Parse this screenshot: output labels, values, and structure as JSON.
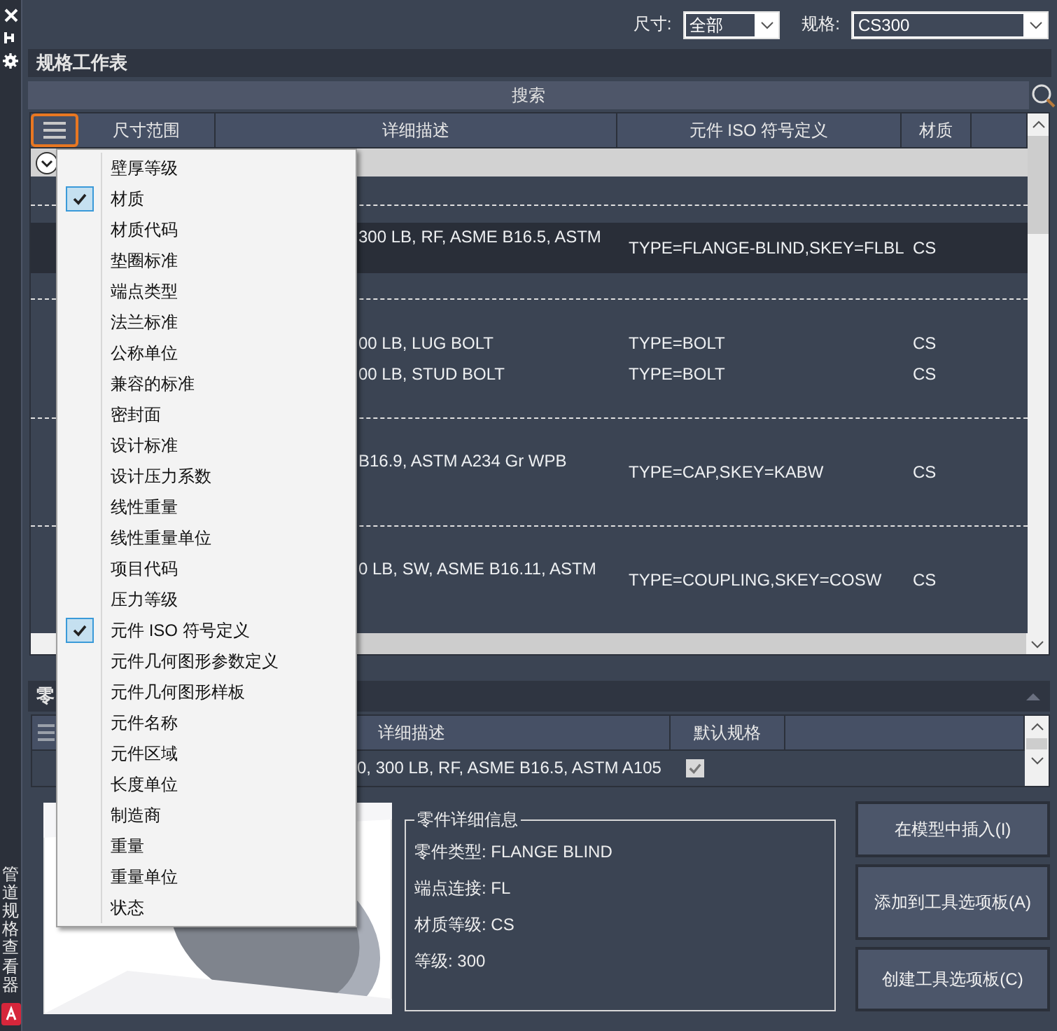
{
  "side_panel": {
    "title": "管道规格查看器"
  },
  "filters": [
    {
      "label": "尺寸:",
      "value": "全部"
    },
    {
      "label": "规格:",
      "value": "CS300"
    }
  ],
  "spec_sheet": {
    "title": "规格工作表",
    "search": {
      "placeholder": "搜索"
    },
    "columns": [
      "尺寸范围",
      "详细描述",
      "元件 ISO 符号定义",
      "材质"
    ],
    "rows": [
      {
        "selected": true,
        "lines": [
          {
            "description": "300 LB, RF, ASME B16.5, ASTM",
            "iso": "TYPE=FLANGE-BLIND,SKEY=FLBL",
            "material": "CS"
          }
        ]
      },
      {
        "selected": false,
        "lines": [
          {
            "description": "00 LB, LUG BOLT",
            "iso": "TYPE=BOLT",
            "material": "CS"
          },
          {
            "description": "00 LB, STUD BOLT",
            "iso": "TYPE=BOLT",
            "material": "CS"
          }
        ]
      },
      {
        "selected": false,
        "lines": [
          {
            "description": "B16.9, ASTM A234 Gr WPB",
            "iso": "TYPE=CAP,SKEY=KABW",
            "material": "CS"
          }
        ]
      },
      {
        "selected": false,
        "lines": [
          {
            "description": "0 LB, SW, ASME B16.11, ASTM",
            "iso": "TYPE=COUPLING,SKEY=COSW",
            "material": "CS"
          }
        ]
      }
    ]
  },
  "column_menu": [
    {
      "label": "壁厚等级",
      "checked": false
    },
    {
      "label": "材质",
      "checked": true
    },
    {
      "label": "材质代码",
      "checked": false
    },
    {
      "label": "垫圈标准",
      "checked": false
    },
    {
      "label": "端点类型",
      "checked": false
    },
    {
      "label": "法兰标准",
      "checked": false
    },
    {
      "label": "公称单位",
      "checked": false
    },
    {
      "label": "兼容的标准",
      "checked": false
    },
    {
      "label": "密封面",
      "checked": false
    },
    {
      "label": "设计标准",
      "checked": false
    },
    {
      "label": "设计压力系数",
      "checked": false
    },
    {
      "label": "线性重量",
      "checked": false
    },
    {
      "label": "线性重量单位",
      "checked": false
    },
    {
      "label": "项目代码",
      "checked": false
    },
    {
      "label": "压力等级",
      "checked": false
    },
    {
      "label": "元件 ISO 符号定义",
      "checked": true
    },
    {
      "label": "元件几何图形参数定义",
      "checked": false
    },
    {
      "label": "元件几何图形样板",
      "checked": false
    },
    {
      "label": "元件名称",
      "checked": false
    },
    {
      "label": "元件区域",
      "checked": false
    },
    {
      "label": "长度单位",
      "checked": false
    },
    {
      "label": "制造商",
      "checked": false
    },
    {
      "label": "重量",
      "checked": false
    },
    {
      "label": "重量单位",
      "checked": false
    },
    {
      "label": "状态",
      "checked": false
    }
  ],
  "parts": {
    "title": "零",
    "columns": [
      "详细描述",
      "默认规格"
    ],
    "rows": [
      {
        "description": "0, 300 LB, RF, ASME B16.5, ASTM A105",
        "default": true
      }
    ]
  },
  "details": {
    "title": "零件详细信息",
    "lines": [
      "零件类型: FLANGE BLIND",
      "端点连接: FL",
      "材质等级: CS",
      "等级: 300"
    ]
  },
  "buttons": [
    "在模型中插入(I)",
    "添加到工具选项板(A)",
    "创建工具选项板(C)"
  ]
}
